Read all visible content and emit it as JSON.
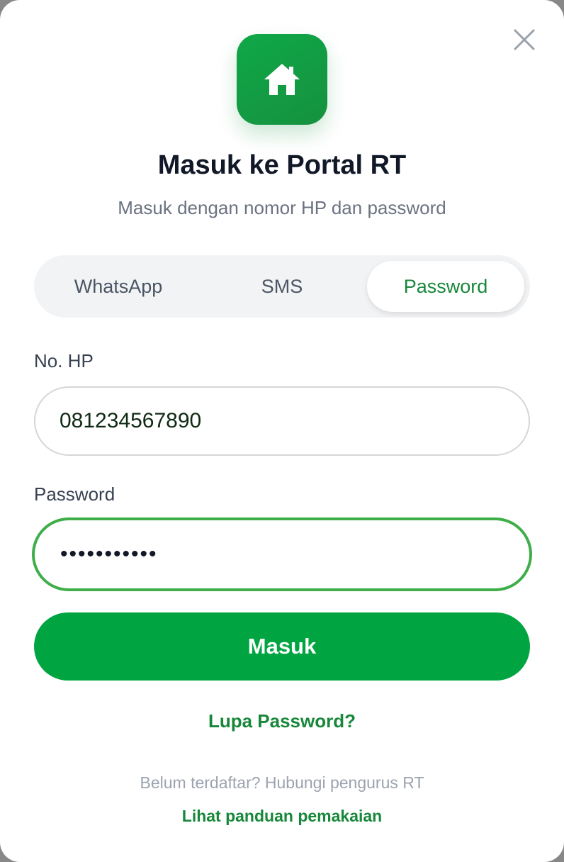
{
  "header": {
    "logo_icon": "home-icon",
    "close_icon": "close-icon",
    "title": "Masuk ke Portal RT",
    "subtitle": "Masuk dengan nomor HP dan password"
  },
  "tabs": [
    {
      "label": "WhatsApp",
      "active": false
    },
    {
      "label": "SMS",
      "active": false
    },
    {
      "label": "Password",
      "active": true
    }
  ],
  "form": {
    "phone_label": "No. HP",
    "phone_value": "081234567890",
    "password_label": "Password",
    "password_masked": "•••••••••••",
    "submit_label": "Masuk"
  },
  "footer": {
    "forgot_label": "Lupa Password?",
    "register_note": "Belum terdaftar? Hubungi pengurus RT",
    "guide_label": "Lihat panduan pemakaian"
  },
  "colors": {
    "brand_green": "#00a542",
    "accent_green_text": "#17873a",
    "focus_ring": "#3fae49"
  }
}
